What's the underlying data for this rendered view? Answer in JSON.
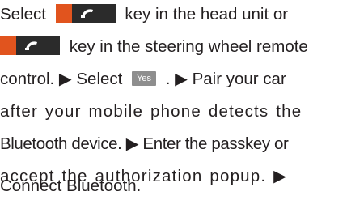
{
  "text": {
    "l1_a": "Select",
    "l1_b": "key in the head unit or",
    "l2_a": "key in the steering wheel remote",
    "l3_a": "control. ▶ Select",
    "l3_b": ". ▶ Pair your car",
    "l4": "after your mobile phone detects the",
    "l5": "Bluetooth device. ▶ Enter the passkey or",
    "l6": "accept the authorization popup. ▶",
    "l7": "Connect Bluetooth."
  },
  "buttons": {
    "yes": "Yes"
  },
  "icons": {
    "call_key": "phone-handset-icon"
  },
  "colors": {
    "text": "#231f20",
    "key_body": "#2b2b2b",
    "key_accent": "#e1541e",
    "yes_button": "#8e8e8e"
  }
}
